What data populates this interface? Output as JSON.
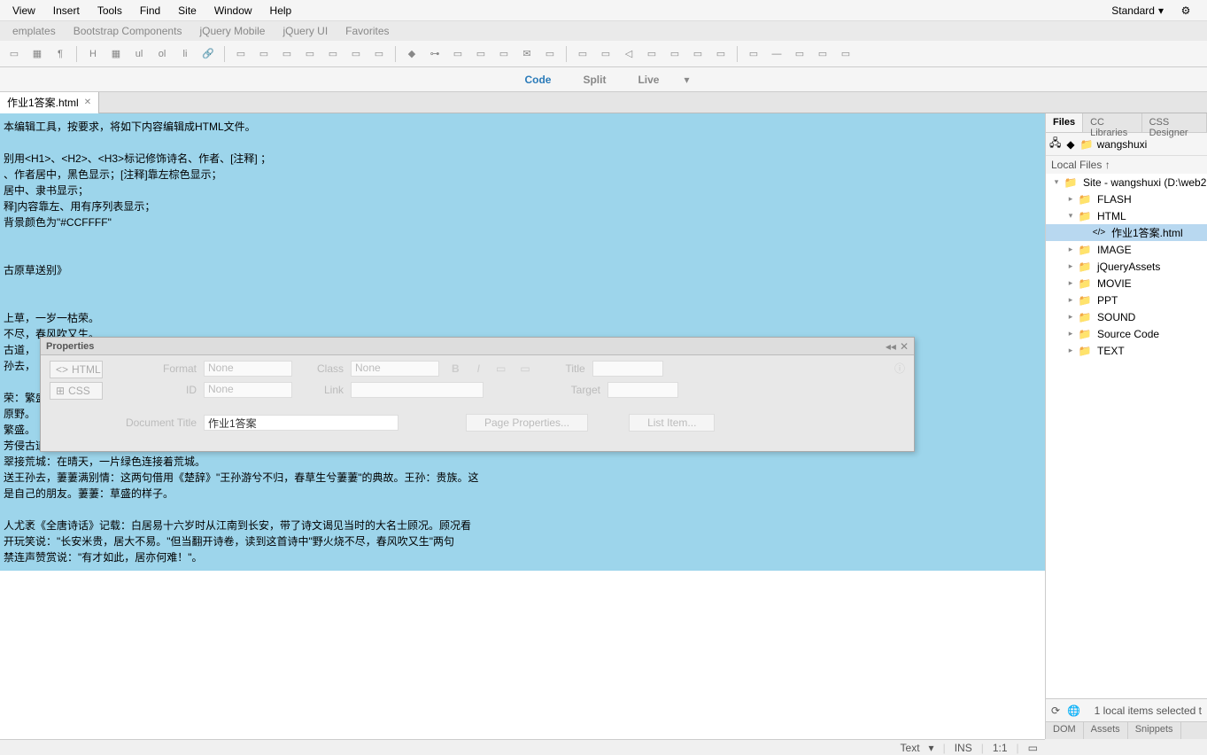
{
  "menubar": {
    "items": [
      "View",
      "Insert",
      "Tools",
      "Find",
      "Site",
      "Window",
      "Help"
    ],
    "workspace": "Standard"
  },
  "secondary": {
    "items": [
      "emplates",
      "Bootstrap Components",
      "jQuery Mobile",
      "jQuery UI",
      "Favorites"
    ]
  },
  "viewswitch": {
    "code": "Code",
    "split": "Split",
    "live": "Live"
  },
  "tab": {
    "name": "作业1答案.html"
  },
  "document": {
    "lines": [
      "本编辑工具，按要求，将如下内容编辑成HTML文件。",
      "",
      "别用<H1>、<H2>、<H3>标记修饰诗名、作者、[注释]  ；",
      "、作者居中，黑色显示；[注释]靠左棕色显示；",
      "居中、隶书显示；",
      "释]内容靠左、用有序列表显示；",
      "背景颜色为\"#CCFFFF\"",
      "",
      "",
      "古原草送别》",
      "",
      "",
      "上草，一岁一枯荣。",
      "不尽，春风吹又生。",
      "古道，",
      "孙去，",
      "",
      "荣：繁盛",
      "原野。",
      "繁盛。",
      "芳侵古道：伸向远方的一片野草，侵占了古老的道路。远芳：牵连一片的草。",
      "翠接荒城：在晴天，一片绿色连接着荒城。",
      "送王孙去，萋萋满别情：这两句借用《楚辞》\"王孙游兮不归，春草生兮萋萋\"的典故。王孙：贵族。这",
      "是自己的朋友。萋萋：草盛的样子。",
      "",
      "人尤袤《全唐诗话》记载：白居易十六岁时从江南到长安，带了诗文谒见当时的大名士顾况。顾况看",
      " 开玩笑说：\"长安米贵，居大不易。\"但当翻开诗卷，读到这首诗中\"野火烧不尽，春风吹又生\"两句",
      "禁连声赞赏说：\"有才如此，居亦何难！\"。"
    ]
  },
  "properties": {
    "title": "Properties",
    "html_tab": "HTML",
    "css_tab": "CSS",
    "format": "Format",
    "format_val": "None",
    "id": "ID",
    "id_val": "None",
    "class": "Class",
    "class_val": "None",
    "link": "Link",
    "titleL": "Title",
    "target": "Target",
    "doc_title_label": "Document Title",
    "doc_title_val": "作业1答案",
    "page_props": "Page Properties...",
    "list_item": "List Item..."
  },
  "files_panel": {
    "tabs": [
      "Files",
      "CC Libraries",
      "CSS Designer"
    ],
    "site_label": "wangshuxi",
    "header": "Local Files ↑",
    "tree": [
      {
        "depth": 0,
        "arrow": "▾",
        "icon": "folder",
        "label": "Site - wangshuxi (D:\\web2"
      },
      {
        "depth": 1,
        "arrow": "▸",
        "icon": "folder",
        "label": "FLASH"
      },
      {
        "depth": 1,
        "arrow": "▾",
        "icon": "folder",
        "label": "HTML"
      },
      {
        "depth": 2,
        "arrow": "",
        "icon": "code",
        "label": "作业1答案.html",
        "selected": true
      },
      {
        "depth": 1,
        "arrow": "▸",
        "icon": "folder",
        "label": "IMAGE"
      },
      {
        "depth": 1,
        "arrow": "▸",
        "icon": "folder",
        "label": "jQueryAssets"
      },
      {
        "depth": 1,
        "arrow": "▸",
        "icon": "folder",
        "label": "MOVIE"
      },
      {
        "depth": 1,
        "arrow": "▸",
        "icon": "folder",
        "label": "PPT"
      },
      {
        "depth": 1,
        "arrow": "▸",
        "icon": "folder",
        "label": "SOUND"
      },
      {
        "depth": 1,
        "arrow": "▸",
        "icon": "folder",
        "label": "Source Code"
      },
      {
        "depth": 1,
        "arrow": "▸",
        "icon": "folder",
        "label": "TEXT"
      }
    ],
    "footer_text": "1 local items selected t",
    "bottom_tabs": [
      "DOM",
      "Assets",
      "Snippets"
    ]
  },
  "statusbar": {
    "text": "Text",
    "ins": "INS",
    "pos": "1:1"
  }
}
